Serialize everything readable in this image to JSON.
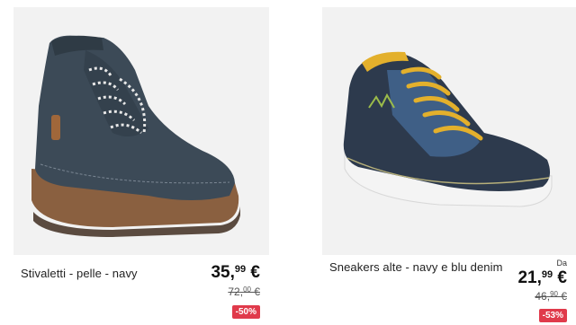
{
  "products": [
    {
      "title": "Stivaletti - pelle - navy",
      "price_int": "35",
      "price_dec": "99",
      "price_currency": " €",
      "old_price_int": "72",
      "old_price_dec": "00",
      "old_price_currency": " €",
      "discount": "-50%"
    },
    {
      "prefix": "Da",
      "title": "Sneakers alte - navy e blu denim",
      "price_int": "21",
      "price_dec": "99",
      "price_currency": " €",
      "old_price_int": "46",
      "old_price_dec": "90",
      "old_price_currency": " €",
      "discount": "-53%"
    }
  ],
  "colors": {
    "badge": "#e03a4b",
    "image_bg": "#f2f2f2",
    "boot_leather": "#3c4a57",
    "sole": "#8a6040",
    "denim": "#3f5f86",
    "laces_yellow": "#e3b02c"
  }
}
